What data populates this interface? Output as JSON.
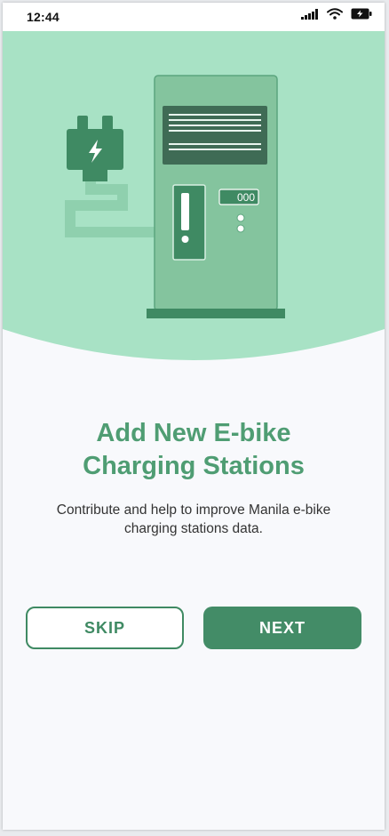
{
  "status_bar": {
    "time": "12:44",
    "icons": [
      "signal-icon",
      "wifi-icon",
      "battery-charging-icon"
    ]
  },
  "illustration": {
    "description_icons": [
      "plug-icon",
      "lightning-bolt-icon",
      "charging-station-icon",
      "display-screen-icon"
    ],
    "station_counter": "000"
  },
  "onboarding": {
    "title": "Add New E-bike\nCharging Stations",
    "subtitle": "Contribute and help to improve Manila e-bike charging stations data."
  },
  "actions": {
    "skip_label": "SKIP",
    "next_label": "NEXT"
  },
  "colors": {
    "hero_background": "#a8e2c5",
    "primary": "#438c67",
    "title": "#4f9d73",
    "page_background": "#f8f9fc"
  }
}
